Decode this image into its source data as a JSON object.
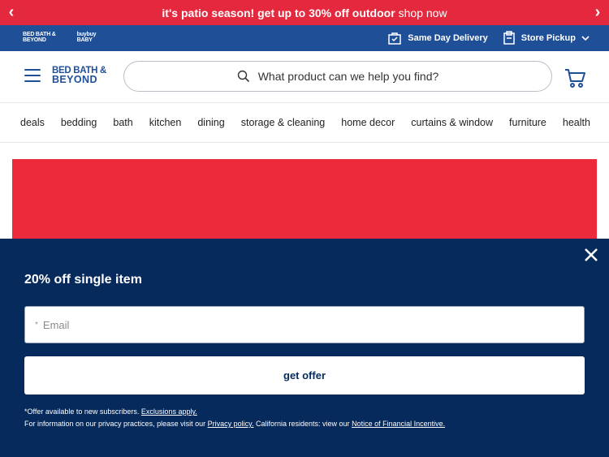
{
  "promo": {
    "headline": "it's patio season! get up to 30% off outdoor",
    "link": "shop now",
    "prev": "‹",
    "next": "›"
  },
  "utility": {
    "logo_bbb_line1": "BED BATH &",
    "logo_bbb_line2": "BEYOND",
    "logo_baby_line1": "buybuy",
    "logo_baby_line2": "BABY",
    "same_day": "Same Day Delivery",
    "store_pickup": "Store Pickup"
  },
  "header": {
    "brand_line1": "BED BATH &",
    "brand_line2": "BEYOND",
    "search_placeholder": "What product can we help you find?"
  },
  "nav": {
    "items": [
      "deals",
      "bedding",
      "bath",
      "kitchen",
      "dining",
      "storage & cleaning",
      "home decor",
      "curtains & window",
      "furniture",
      "health"
    ]
  },
  "modal": {
    "title": "20% off single item",
    "email_required": "*",
    "email_placeholder": "Email",
    "cta": "get offer",
    "fine_prefix": "*Offer available to new subscribers.",
    "exclusions_link": "Exclusions apply.",
    "privacy_prefix": "For information on our privacy practices, please visit our",
    "privacy_link": "Privacy policy.",
    "california_text": "California residents: view our",
    "notice_link": "Notice of Financial Incentive."
  },
  "colors": {
    "promo_red": "#e4283d",
    "utility_blue": "#1f4f97",
    "modal_navy": "#062a5b",
    "hero_red": "#ed2a3c"
  }
}
